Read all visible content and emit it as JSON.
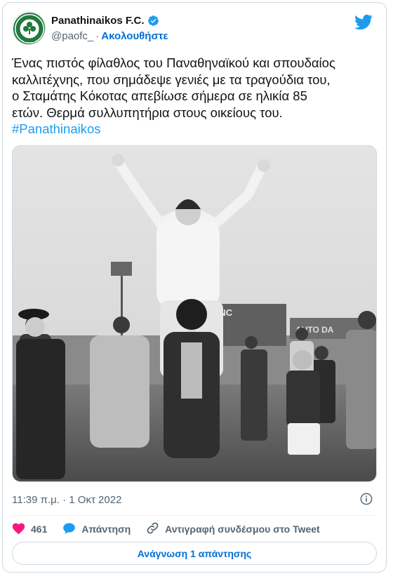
{
  "account": {
    "name": "Panathinaikos F.C.",
    "handle": "@paofc_",
    "separator": "·",
    "follow_label": "Ακολουθήστε",
    "avatar_text": "PANATHINAIKOS 1908",
    "avatar_year": "1908"
  },
  "tweet": {
    "lines": [
      "Ένας πιστός φίλαθλος του Παναθηναϊκού και σπουδαίος",
      "καλλιτέχνης, που σημάδεψε γενιές με τα τραγούδια του,",
      "ο Σταμάτης Κόκοτας απεβίωσε σήμερα σε ηλικία 85",
      "ετών. Θερμά συλλυπητήρια στους οικείους του."
    ],
    "hashtag": "#Panathinaikos"
  },
  "photo": {
    "stadium_sign": "HNC",
    "ad_sign": "AUTO DA"
  },
  "meta": {
    "time": "11:39 π.μ.",
    "separator": "·",
    "date": "1 Οκτ 2022"
  },
  "actions": {
    "like_count": "461",
    "reply_label": "Απάντηση",
    "copy_link_label": "Αντιγραφή συνδέσμου στο Tweet"
  },
  "read_replies_label": "Ανάγνωση 1 απάντησης",
  "colors": {
    "accent": "#1d9bf0",
    "link": "#006fd6",
    "like": "#f91880",
    "club_green": "#1f7a3d"
  }
}
